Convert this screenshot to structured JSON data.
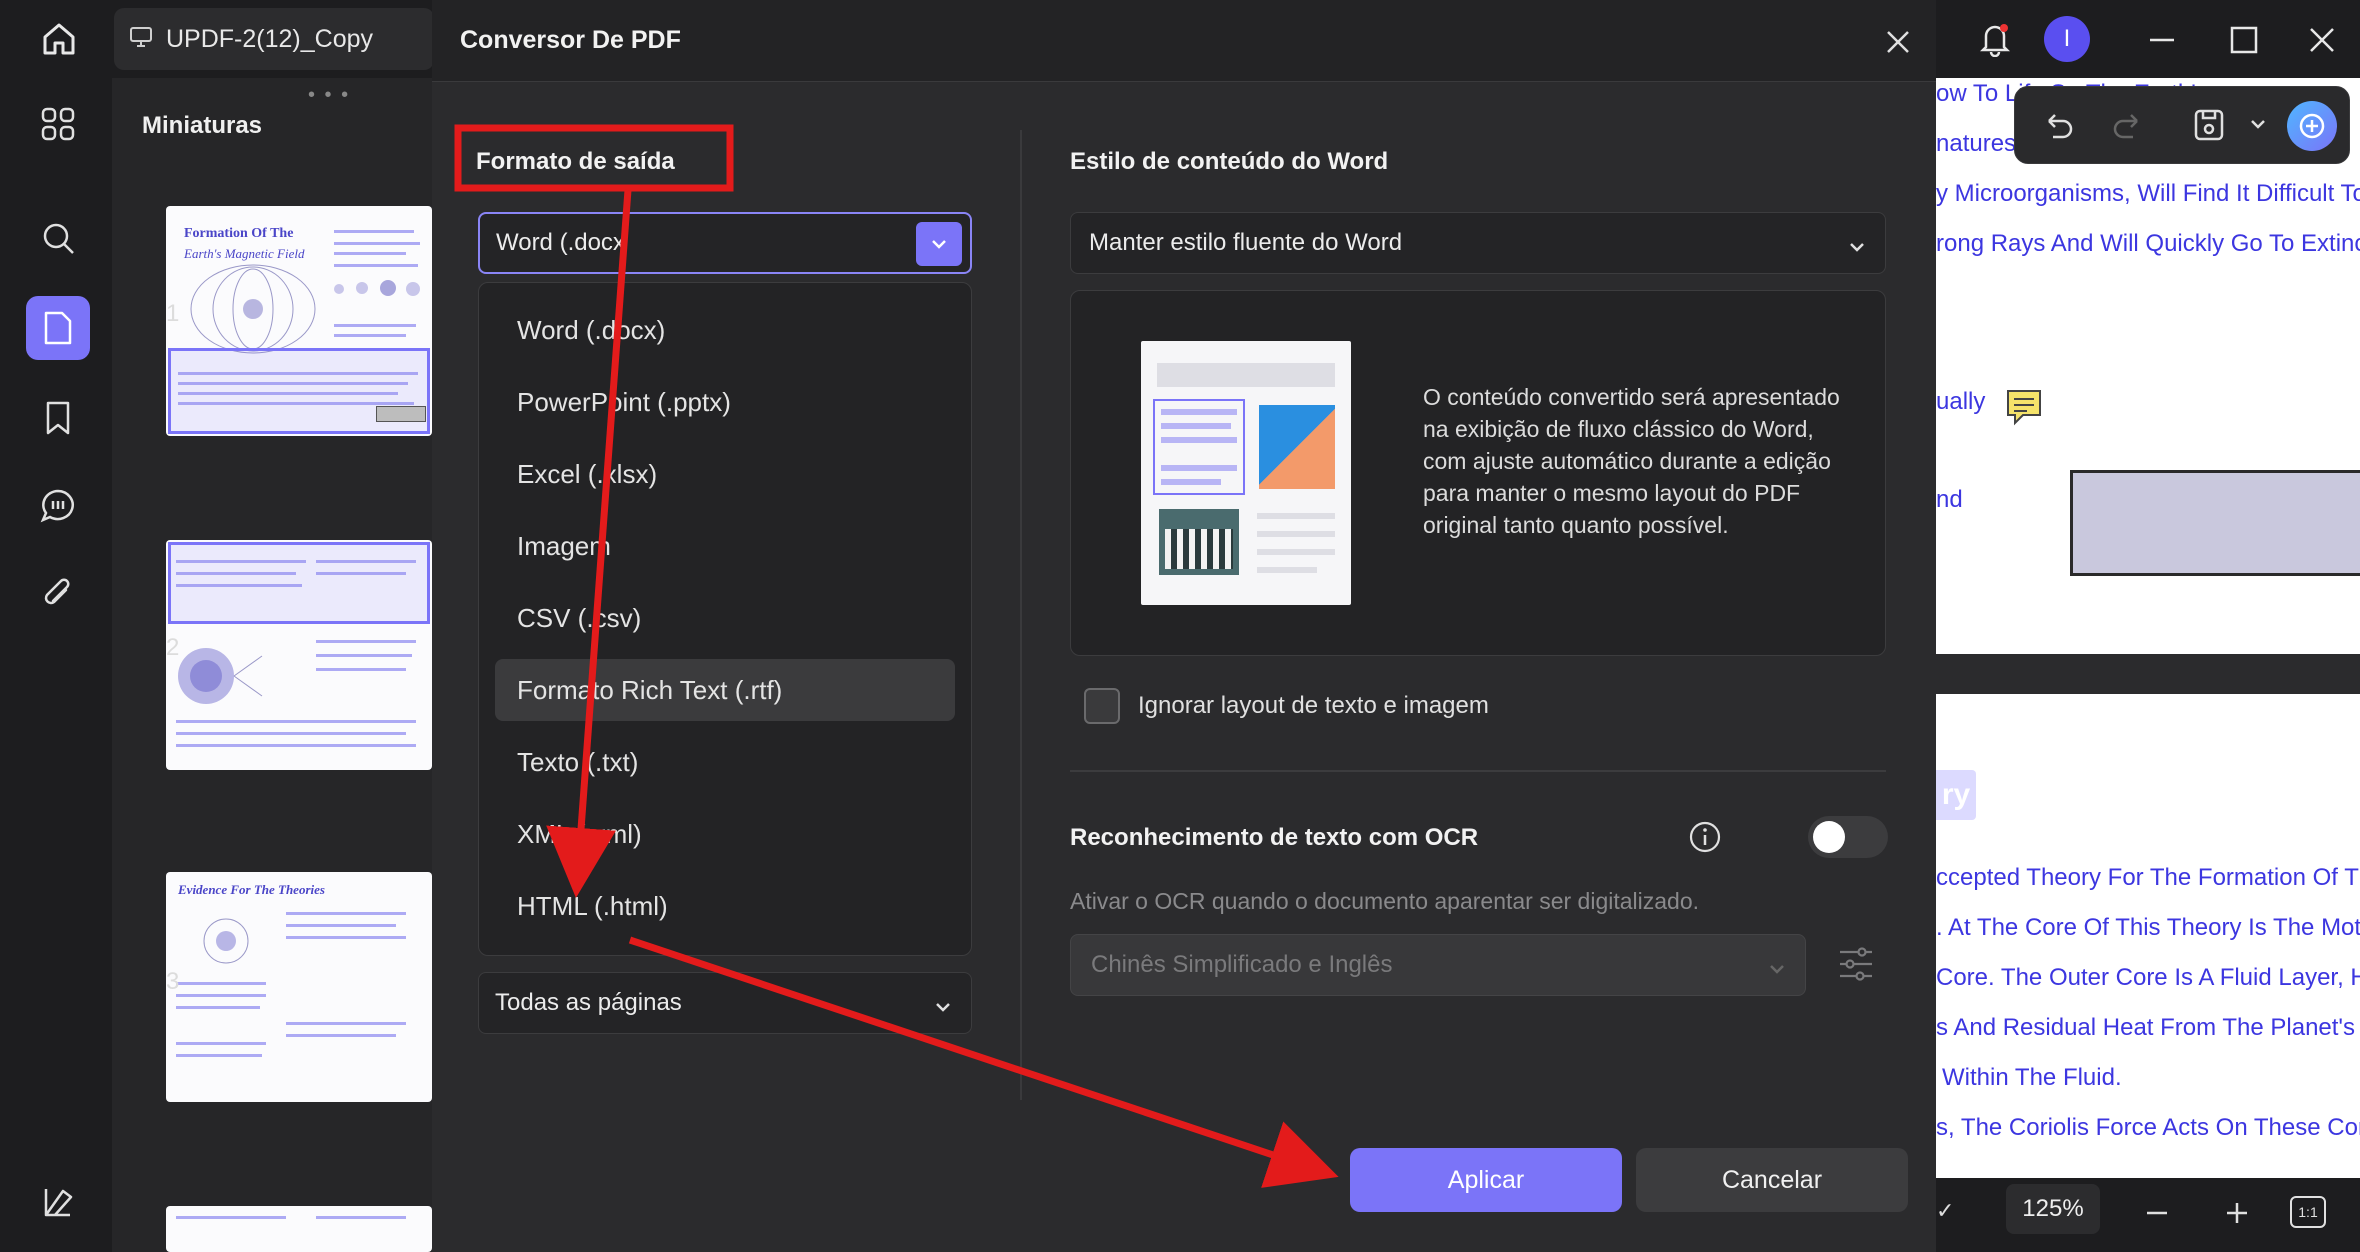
{
  "titlebar": {
    "doc_tab": "UPDF-2(12)_Copy",
    "avatar_initial": "I"
  },
  "thumbnails": {
    "title": "Miniaturas",
    "pages": [
      {
        "num": "1",
        "heading": "Formation Of The",
        "heading2": "Earth's Magnetic Field"
      },
      {
        "num": "2"
      },
      {
        "num": "3",
        "heading": "Evidence For The Theories"
      }
    ]
  },
  "document": {
    "lines": [
      "ow To Life So The Earth's",
      "natures O",
      "y Microorganisms, Will Find It Difficult To",
      "rong Rays And Will Quickly Go To Extinc",
      "ually",
      "nd",
      "ccepted Theory For The Formation Of The",
      ". At The Core Of This Theory Is The Moti",
      "Core. The Outer Core Is A Fluid Layer, H",
      "s And Residual Heat From The Planet's",
      "Within The Fluid.",
      "s, The Coriolis Force Acts On These Con"
    ],
    "chip_text": "ry",
    "zoom": "125%"
  },
  "modal": {
    "title": "Conversor De PDF",
    "output_format_label": "Formato de saída",
    "selected_format": "Word (.docx",
    "formats": [
      "Word (.docx)",
      "PowerPoint (.pptx)",
      "Excel (.xlsx)",
      "Imagem",
      "CSV (.csv)",
      "Formato Rich Text (.rtf)",
      "Texto (.txt)",
      "XML (.xml)",
      "HTML (.html)"
    ],
    "highlighted_index": 5,
    "pages_range": "Todas as páginas",
    "word_style_label": "Estilo de conteúdo do Word",
    "word_style_value": "Manter estilo fluente do Word",
    "preview_description": "O conteúdo convertido será apresentado na exibição de fluxo clássico do Word, com ajuste automático durante a edição para manter o mesmo layout do PDF original tanto quanto possível.",
    "ignore_layout_label": "Ignorar layout de texto e imagem",
    "ocr_label": "Reconhecimento de texto com OCR",
    "ocr_description": "Ativar o OCR quando o documento aparentar ser digitalizado.",
    "ocr_language": "Chinês Simplificado e Inglês",
    "apply_label": "Aplicar",
    "cancel_label": "Cancelar"
  },
  "colors": {
    "accent": "#7b74f8",
    "annotation": "#e31b1b",
    "doc_link": "#3c36e0"
  }
}
